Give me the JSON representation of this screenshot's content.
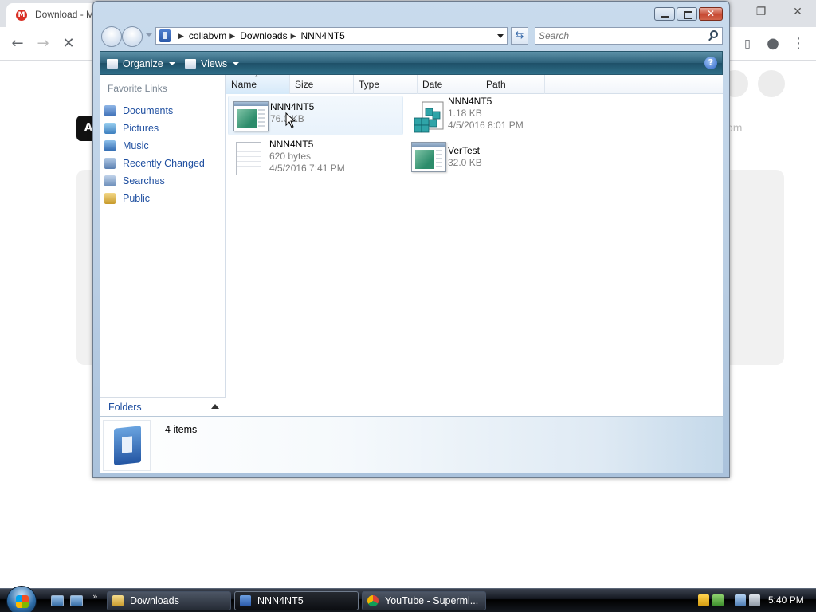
{
  "browser": {
    "tab_title": "Download - M",
    "chip_letter": "A",
    "partial_domain": "om",
    "colors": {
      "favicon": "#d93025"
    }
  },
  "explorer": {
    "breadcrumb": [
      "collabvm",
      "Downloads",
      "NNN4NT5"
    ],
    "search_placeholder": "Search",
    "toolbar": {
      "organize": "Organize",
      "views": "Views",
      "help": "?"
    },
    "sidebar": {
      "heading": "Favorite Links",
      "items": [
        {
          "label": "Documents",
          "icon": "documents-icon"
        },
        {
          "label": "Pictures",
          "icon": "pictures-icon"
        },
        {
          "label": "Music",
          "icon": "music-icon"
        },
        {
          "label": "Recently Changed",
          "icon": "recently-changed-icon"
        },
        {
          "label": "Searches",
          "icon": "searches-icon"
        },
        {
          "label": "Public",
          "icon": "public-icon"
        }
      ],
      "folders_label": "Folders"
    },
    "columns": [
      "Name",
      "Size",
      "Type",
      "Date",
      "Path"
    ],
    "files": [
      {
        "name": "NNN4NT5",
        "line2": "76.0 KB",
        "line3": "",
        "icon": "application-icon"
      },
      {
        "name": "NNN4NT5",
        "line2": "1.18 KB",
        "line3": "4/5/2016 8:01 PM",
        "icon": "registry-file-icon"
      },
      {
        "name": "NNN4NT5",
        "line2": "620 bytes",
        "line3": "4/5/2016 7:41 PM",
        "icon": "text-file-icon"
      },
      {
        "name": "VerTest",
        "line2": "32.0 KB",
        "line3": "",
        "icon": "application-icon"
      }
    ],
    "status": {
      "item_count": "4 items"
    }
  },
  "taskbar": {
    "tasks": [
      {
        "label": "Downloads",
        "icon": "folder-icon"
      },
      {
        "label": "NNN4NT5",
        "icon": "explorer-icon"
      },
      {
        "label": "YouTube - Supermi...",
        "icon": "chrome-icon"
      }
    ],
    "clock": "5:40 PM"
  }
}
